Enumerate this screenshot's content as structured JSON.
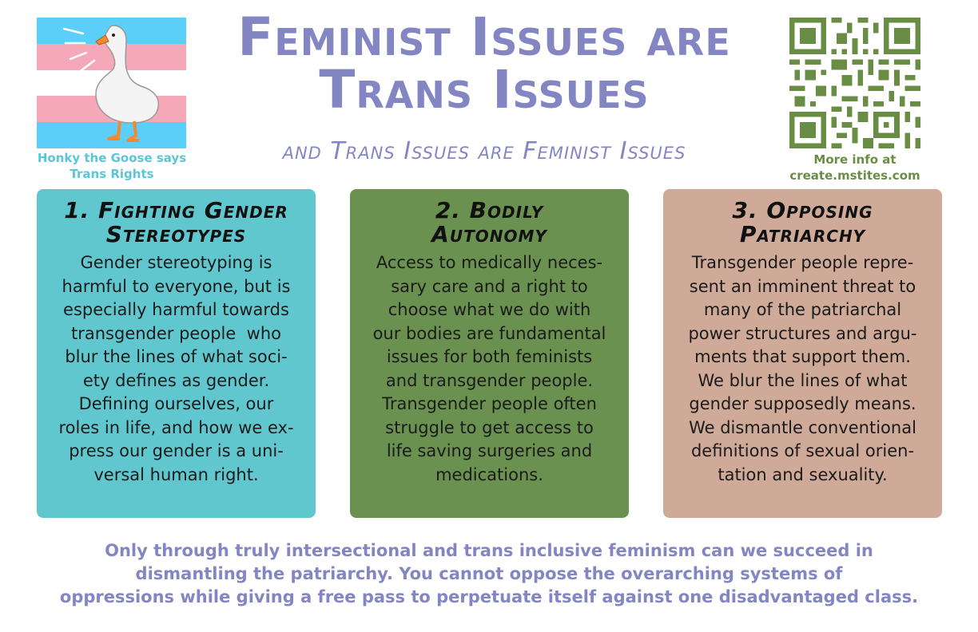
{
  "colors": {
    "accent": "#8386c2",
    "flag_blue": "#5bcefa",
    "flag_pink": "#f5a9b8",
    "flag_white": "#ffffff",
    "card1": "#61c7cf",
    "card2": "#6b9150",
    "card3": "#d0aa98",
    "qr": "#6a8d46"
  },
  "icons": {
    "mascot": "goose-icon",
    "qr": "qr-code-icon"
  },
  "mascot": {
    "caption_lines": [
      "Honky the Goose says",
      "Trans Rights"
    ]
  },
  "header": {
    "title_lines": [
      "Feminist Issues are",
      "Trans Issues"
    ],
    "subtitle": "and Trans Issues are Feminist Issues"
  },
  "qr": {
    "caption_lines": [
      "More info at",
      "create.mstites.com"
    ]
  },
  "cards": [
    {
      "heading_lines": [
        "1. Fighting Gender",
        "Stereotypes"
      ],
      "body_lines": [
        "Gender stereotyping is",
        "harmful to everyone, but is",
        "especially harmful towards",
        "transgender people  who",
        "blur the lines of what soci-",
        "ety defines as gender.",
        "Defining ourselves, our",
        "roles in life, and how we ex-",
        "press our gender is a uni-",
        "versal human right."
      ]
    },
    {
      "heading_lines": [
        "2. Bodily",
        "Autonomy"
      ],
      "body_lines": [
        "Access to medically neces-",
        "sary care and a right to",
        "choose what we do with",
        "our bodies are fundamental",
        "issues for both feminists",
        "and transgender people.",
        "Transgender people often",
        "struggle to get access to",
        "life saving surgeries and",
        "medications."
      ]
    },
    {
      "heading_lines": [
        "3. Opposing",
        "Patriarchy"
      ],
      "body_lines": [
        "Transgender people repre-",
        "sent an imminent threat to",
        "many of the patriarchal",
        "power structures and argu-",
        "ments that support them.",
        "We blur the lines of what",
        "gender supposedly means.",
        "We dismantle conventional",
        "definitions of sexual orien-",
        "tation and sexuality."
      ]
    }
  ],
  "footer": {
    "lines": [
      "Only through truly intersectional and trans inclusive feminism can we succeed in",
      "dismantling the patriarchy. You cannot oppose the overarching systems of",
      "oppressions while giving a free pass to perpetuate itself against one disadvantaged class."
    ]
  }
}
